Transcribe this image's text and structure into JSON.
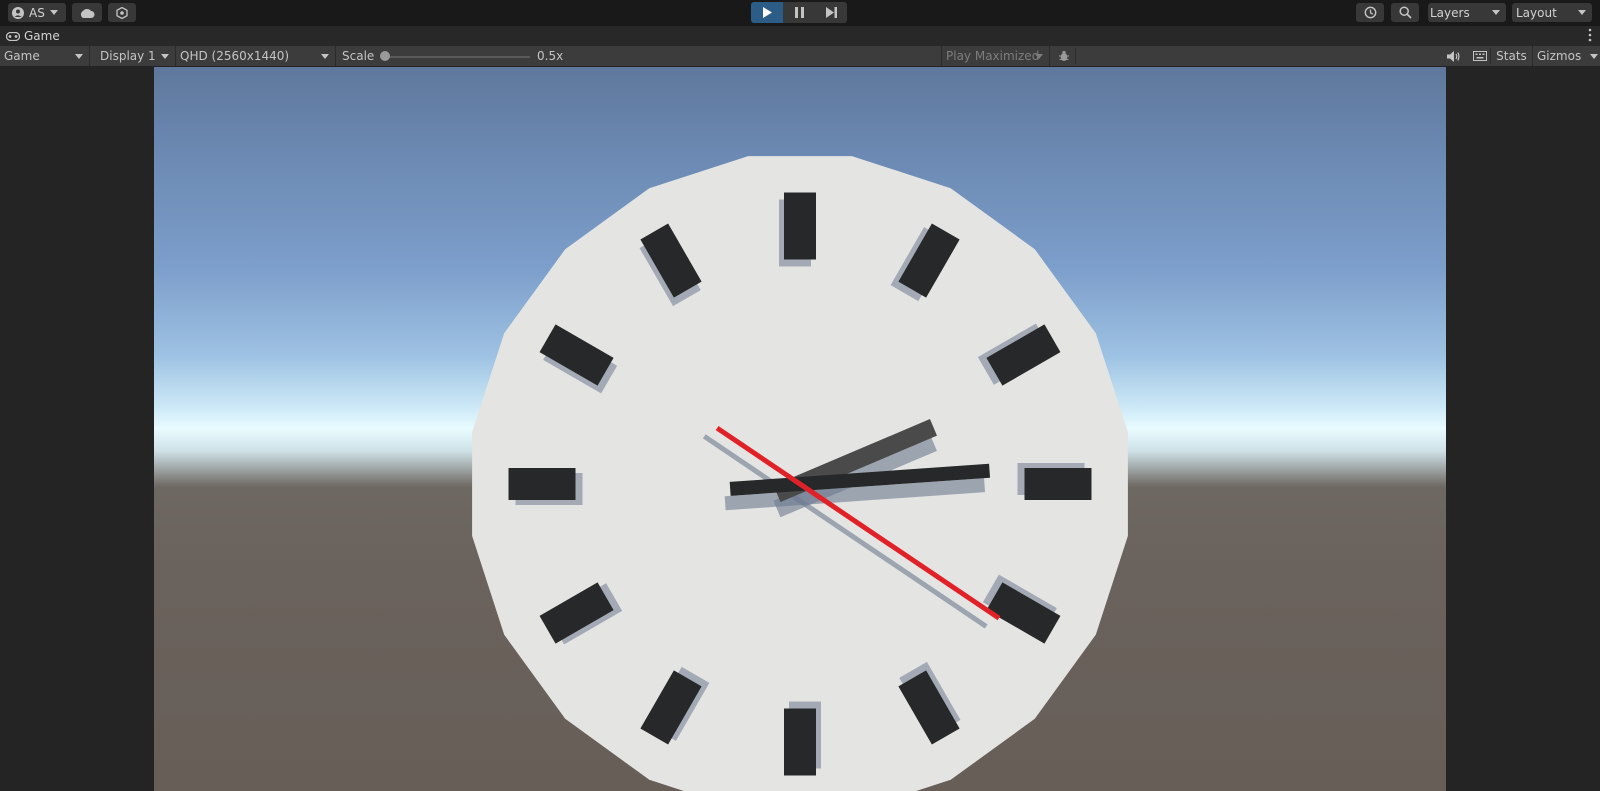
{
  "topbar": {
    "account_label": "AS",
    "layers_label": "Layers",
    "layout_label": "Layout",
    "play_state": "playing",
    "icons": [
      "account-icon",
      "cloud-icon",
      "collab-icon",
      "play-icon",
      "pause-icon",
      "step-icon",
      "history-icon",
      "search-icon"
    ]
  },
  "panel": {
    "tab_title": "Game"
  },
  "toolbar": {
    "view_mode": "Game",
    "display": "Display 1",
    "resolution": "QHD (2560x1440)",
    "scale_label": "Scale",
    "scale_value": "0.5x",
    "scale_fraction": 0.0,
    "play_mode": "Play Maximized",
    "stats_label": "Stats",
    "gizmos_label": "Gizmos",
    "icons": [
      "bug-icon",
      "audio-icon",
      "keyboard-icon"
    ]
  },
  "clock": {
    "hour_markers": 12,
    "hour_hand_angle_deg": 67,
    "minute_hand_angle_deg": 86,
    "second_hand_angle_deg": 124,
    "colors": {
      "face": "#e4e4e2",
      "marker": "#262829",
      "hour_hand": "#4a4a4a",
      "minute_hand": "#262829",
      "second_hand": "#e02228",
      "shadow": "#6d7a8f"
    }
  }
}
